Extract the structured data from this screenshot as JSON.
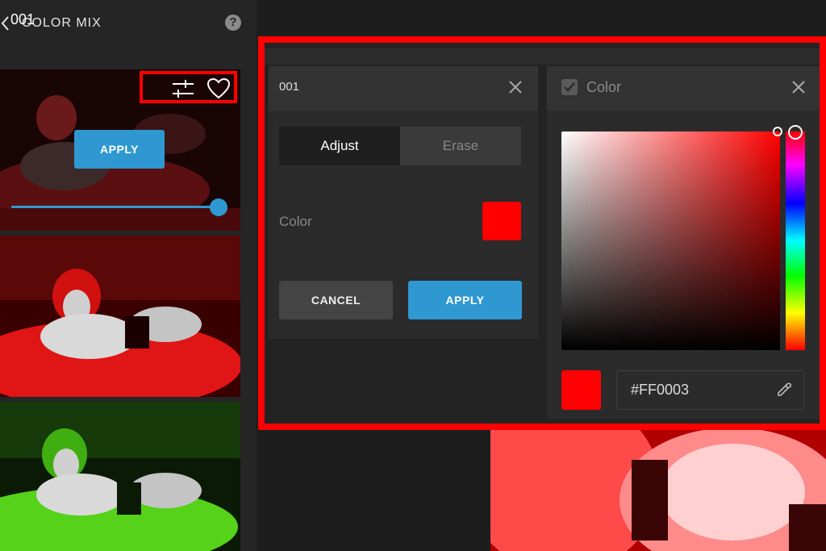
{
  "sidebar": {
    "title": "COLOR MIX",
    "help_glyph": "?",
    "presets": [
      {
        "name": "001",
        "apply_label": "APPLY",
        "slider_value": 1.0
      },
      {
        "name": ""
      },
      {
        "name": ""
      }
    ]
  },
  "dialog": {
    "title": "001",
    "tabs": [
      {
        "label": "Adjust",
        "active": true
      },
      {
        "label": "Erase",
        "active": false
      }
    ],
    "color_label": "Color",
    "color_value": "#FF0000",
    "cancel_label": "CANCEL",
    "apply_label": "APPLY"
  },
  "picker": {
    "title": "Color",
    "hex_value": "#FF0003",
    "hue": "red"
  },
  "colors": {
    "accent": "#2f98d1",
    "highlight": "#ff0000",
    "panel": "#2b2b2b",
    "background": "#1d1d1d"
  },
  "icons": [
    "back-icon",
    "help-icon",
    "adjust-icon",
    "heart-icon",
    "close-icon",
    "eyedropper-icon"
  ]
}
